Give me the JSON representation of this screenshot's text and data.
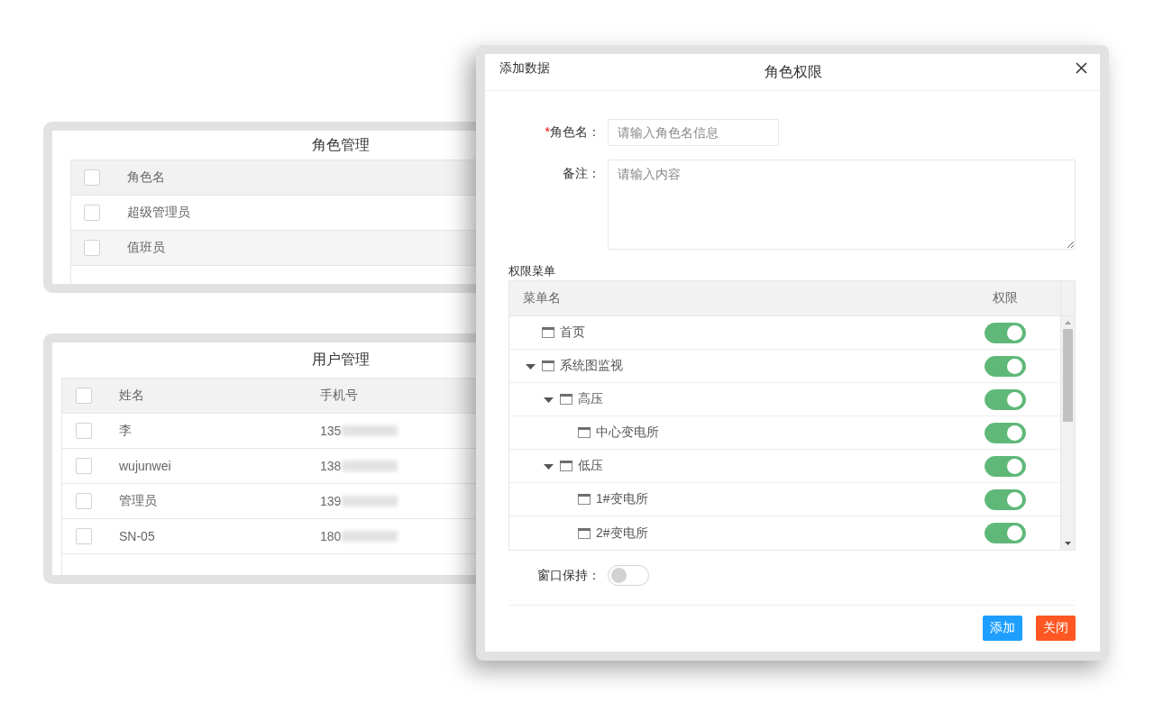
{
  "role_panel": {
    "title": "角色管理",
    "columns": [
      "角色名"
    ],
    "header_checked": false,
    "rows": [
      {
        "name": "超级管理员",
        "checked": false
      },
      {
        "name": "值班员",
        "checked": false
      }
    ]
  },
  "user_panel": {
    "title": "用户管理",
    "columns": [
      "姓名",
      "手机号"
    ],
    "header_checked": false,
    "rows": [
      {
        "name": "李",
        "phone": "135",
        "checked": false
      },
      {
        "name": "wujunwei",
        "phone": "138",
        "checked": false
      },
      {
        "name": "管理员",
        "phone": "139",
        "checked": false
      },
      {
        "name": "SN-05",
        "phone": "180",
        "checked": false
      }
    ]
  },
  "dialog": {
    "corner_label": "添加数据",
    "title": "角色权限",
    "fields": [
      {
        "kind": "input",
        "label": "角色名：",
        "required_mark": "*",
        "placeholder": "请输入角色名信息"
      },
      {
        "kind": "textarea",
        "label": "备注：",
        "placeholder": "请输入内容"
      }
    ],
    "menu_section_label": "权限菜单",
    "menu_table": {
      "columns": [
        "菜单名",
        "权限"
      ],
      "tree": [
        {
          "label": "首页",
          "enabled": true
        },
        {
          "label": "系统图监视",
          "enabled": true,
          "expanded": true,
          "children": [
            {
              "label": "高压",
              "enabled": true,
              "expanded": true,
              "children": [
                {
                  "label": "中心变电所",
                  "enabled": true
                }
              ]
            },
            {
              "label": "低压",
              "enabled": true,
              "expanded": true,
              "children": [
                {
                  "label": "1#变电所",
                  "enabled": true
                },
                {
                  "label": "2#变电所",
                  "enabled": true
                }
              ]
            }
          ]
        }
      ]
    },
    "window_keep": {
      "label": "窗口保持：",
      "on": false
    },
    "buttons": [
      {
        "label": "添加",
        "kind": "primary"
      },
      {
        "label": "关闭",
        "kind": "danger"
      }
    ]
  }
}
